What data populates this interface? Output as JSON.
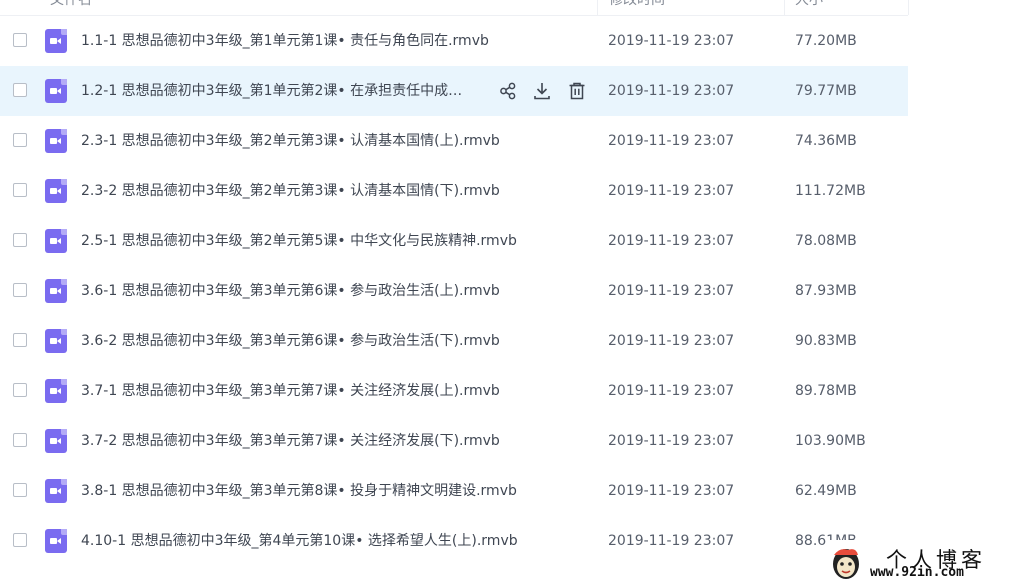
{
  "columns": {
    "name": "文件名",
    "modified": "修改时间",
    "size": "大小"
  },
  "files": [
    {
      "name": "1.1-1 思想品德初中3年级_第1单元第1课• 责任与角色同在.rmvb",
      "date": "2019-11-19 23:07",
      "size": "77.20MB"
    },
    {
      "name": "1.2-1 思想品德初中3年级_第1单元第2课• 在承担责任中成…",
      "date": "2019-11-19 23:07",
      "size": "79.77MB"
    },
    {
      "name": "2.3-1 思想品德初中3年级_第2单元第3课• 认清基本国情(上).rmvb",
      "date": "2019-11-19 23:07",
      "size": "74.36MB"
    },
    {
      "name": "2.3-2 思想品德初中3年级_第2单元第3课• 认清基本国情(下).rmvb",
      "date": "2019-11-19 23:07",
      "size": "111.72MB"
    },
    {
      "name": "2.5-1 思想品德初中3年级_第2单元第5课• 中华文化与民族精神.rmvb",
      "date": "2019-11-19 23:07",
      "size": "78.08MB"
    },
    {
      "name": "3.6-1 思想品德初中3年级_第3单元第6课• 参与政治生活(上).rmvb",
      "date": "2019-11-19 23:07",
      "size": "87.93MB"
    },
    {
      "name": "3.6-2 思想品德初中3年级_第3单元第6课• 参与政治生活(下).rmvb",
      "date": "2019-11-19 23:07",
      "size": "90.83MB"
    },
    {
      "name": "3.7-1 思想品德初中3年级_第3单元第7课• 关注经济发展(上).rmvb",
      "date": "2019-11-19 23:07",
      "size": "89.78MB"
    },
    {
      "name": "3.7-2 思想品德初中3年级_第3单元第7课• 关注经济发展(下).rmvb",
      "date": "2019-11-19 23:07",
      "size": "103.90MB"
    },
    {
      "name": "3.8-1 思想品德初中3年级_第3单元第8课• 投身于精神文明建设.rmvb",
      "date": "2019-11-19 23:07",
      "size": "62.49MB"
    },
    {
      "name": "4.10-1 思想品德初中3年级_第4单元第10课• 选择希望人生(上).rmvb",
      "date": "2019-11-19 23:07",
      "size": "88.61MB"
    }
  ],
  "hover_row": 1,
  "row_actions": [
    "share-icon",
    "download-icon",
    "delete-icon"
  ],
  "watermark": {
    "title": "个人博客",
    "url": "www.92in.com"
  },
  "colors": {
    "accent": "#06a7ff",
    "hover_bg": "#e9f5fd",
    "video_icon": "#7a6bf0"
  }
}
